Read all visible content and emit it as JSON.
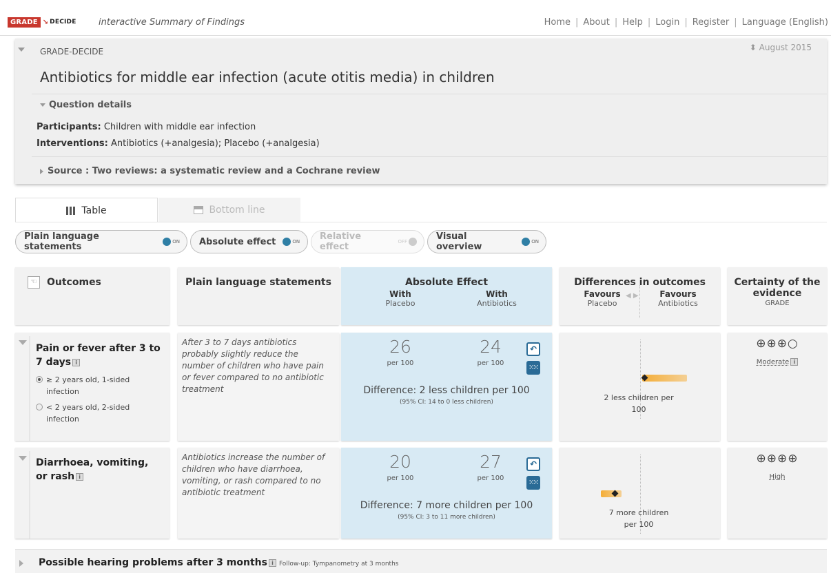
{
  "topbar": {
    "logo_grade": "GRADE",
    "logo_arrow": "↘",
    "logo_decide": "DECIDE",
    "subtitle": "interactive Summary of Findings",
    "nav": [
      "Home",
      "About",
      "Help",
      "Login",
      "Register",
      "Language (English)"
    ]
  },
  "header": {
    "pretitle": "GRADE-DECIDE",
    "date": "⬍ August 2015",
    "title": "Antibiotics for middle ear infection (acute otitis media) in children",
    "question_details_label": "Question details",
    "participants_label": "Participants:",
    "participants_value": " Children with middle ear infection",
    "interventions_label": "Interventions:",
    "interventions_value": " Antibiotics (+analgesia); Placebo (+analgesia)",
    "source_label": "Source : Two reviews: a systematic review and a Cochrane review"
  },
  "tabs": [
    {
      "label": "Table",
      "icon": "table-icon",
      "active": true
    },
    {
      "label": "Bottom line",
      "icon": "bottom-line-icon",
      "active": false
    }
  ],
  "toggles": [
    {
      "label": "Plain language statements",
      "state": "ON",
      "enabled": true
    },
    {
      "label": "Absolute effect",
      "state": "ON",
      "enabled": true
    },
    {
      "label": "Relative effect",
      "state": "OFF",
      "enabled": false
    },
    {
      "label": "Visual overview",
      "state": "ON",
      "enabled": true
    }
  ],
  "columns": {
    "outcomes": "Outcomes",
    "pls": "Plain language statements",
    "absolute": "Absolute Effect",
    "with_placebo_1": "With",
    "with_placebo_2": "Placebo",
    "with_antibiotics_1": "With",
    "with_antibiotics_2": "Antibiotics",
    "differences": "Differences in outcomes",
    "favours_placebo_1": "Favours",
    "favours_placebo_2": "Placebo",
    "favours_antibiotics_1": "Favours",
    "favours_antibiotics_2": "Antibiotics",
    "certainty_1": "Certainty of the",
    "certainty_2": "evidence",
    "certainty_sub": "GRADE"
  },
  "rows": [
    {
      "outcome_1": "Pain or fever after 3 to",
      "outcome_2": "7 days",
      "options": [
        {
          "label_1": "≥ 2 years old, 1-sided",
          "label_2": "infection",
          "selected": true
        },
        {
          "label_1": "< 2 years old, 2-sided",
          "label_2": "infection",
          "selected": false
        }
      ],
      "pls": [
        "After 3 to 7 days antibiotics",
        "probably slightly reduce the",
        "number of children who have pain",
        "or fever compared to no antibiotic",
        "treatment"
      ],
      "placebo": "26",
      "antibiotics": "24",
      "per": "per 100",
      "difference": "Difference: 2 less children per 100",
      "ci": "(95% CI: 14 to 0 less children)",
      "diff_note_1": "2 less children per",
      "diff_note_2": "100",
      "certainty_symbols": "⊕⊕⊕○",
      "certainty_label": "Moderate"
    },
    {
      "outcome_1": "Diarrhoea, vomiting,",
      "outcome_2": "or rash",
      "pls": [
        "Antibiotics increase the number of",
        "children who have diarrhoea,",
        "vomiting, or rash compared to no",
        "antibiotic treatment"
      ],
      "placebo": "20",
      "antibiotics": "27",
      "per": "per 100",
      "difference": "Difference: 7 more children per 100",
      "ci": "(95% CI: 3 to 11 more children)",
      "diff_note_1": "7 more children",
      "diff_note_2": "per 100",
      "certainty_symbols": "⊕⊕⊕⊕",
      "certainty_label": "High"
    }
  ],
  "row3": {
    "outcome": "Possible hearing problems after 3 months",
    "followup": "Follow-up: Tympanometry at 3 months"
  },
  "colors": {
    "accent_blue": "#2a6b96",
    "toggle_on": "#2f7fa5",
    "grade_red": "#c8372d",
    "ci_bar": "#f5a623",
    "absolute_col_bg": "#d8eaf4"
  }
}
